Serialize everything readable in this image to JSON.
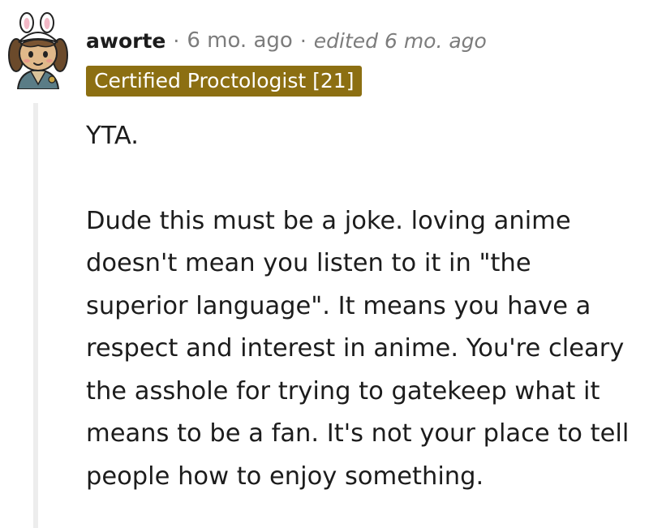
{
  "comment": {
    "username": "aworte",
    "separator": "·",
    "time_ago": "6 mo. ago",
    "edited": "edited 6 mo. ago",
    "flair": "Certified Proctologist [21]",
    "paragraphs": [
      "YTA.",
      "Dude this must be a joke. loving anime doesn't mean you listen to it in \"the superior language\". It means you have a respect and interest in anime. You're cleary the asshole for trying to gatekeep what it means to be a fan. It's not your place to tell people how to enjoy something."
    ]
  },
  "colors": {
    "flair_bg": "#8c6f12",
    "flair_text": "#ffffff",
    "meta_text": "#7c7c7c",
    "body_text": "#1c1c1c",
    "thread_line": "#ededed"
  },
  "icons": {
    "avatar": "snoo-avatar-bunny-hat"
  }
}
